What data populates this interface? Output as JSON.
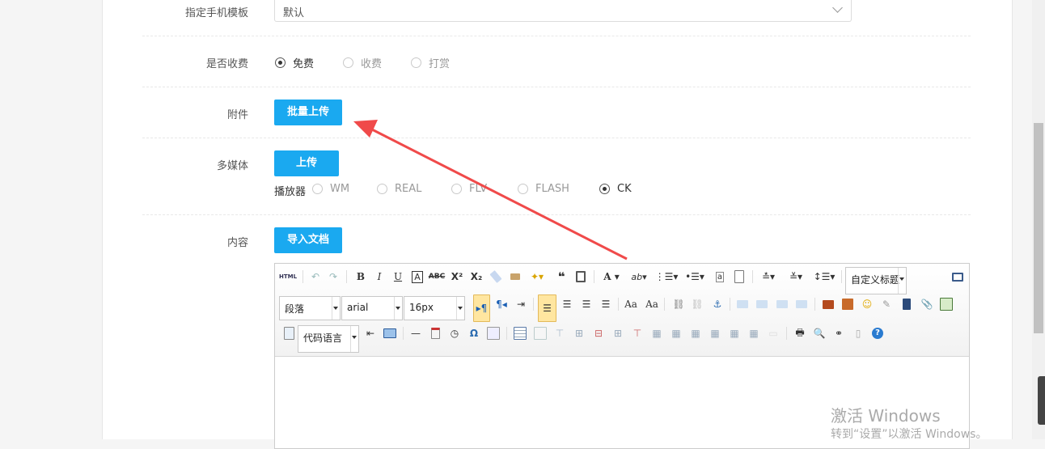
{
  "form": {
    "mobile_template": {
      "label": "指定手机模板",
      "value": "默认"
    },
    "charge": {
      "label": "是否收费",
      "options": [
        "免费",
        "收费",
        "打赏"
      ],
      "selected": "免费"
    },
    "attachment": {
      "label": "附件",
      "button": "批量上传"
    },
    "media": {
      "label": "多媒体",
      "button": "上传",
      "player_label": "播放器",
      "players": [
        "WM",
        "REAL",
        "FLV",
        "FLASH",
        "CK"
      ],
      "selected": "CK"
    },
    "content": {
      "label": "内容",
      "button": "导入文档"
    }
  },
  "editor": {
    "html_label": "HTML",
    "custom_heading": "自定义标题",
    "paragraph": "段落",
    "font_family": "arial",
    "font_size": "16px",
    "code_language": "代码语言"
  },
  "watermark": {
    "title": "激活 Windows",
    "subtitle": "转到“设置”以激活 Windows。"
  },
  "colors": {
    "accent": "#1aa9f0",
    "arrow": "#f04a4a"
  }
}
